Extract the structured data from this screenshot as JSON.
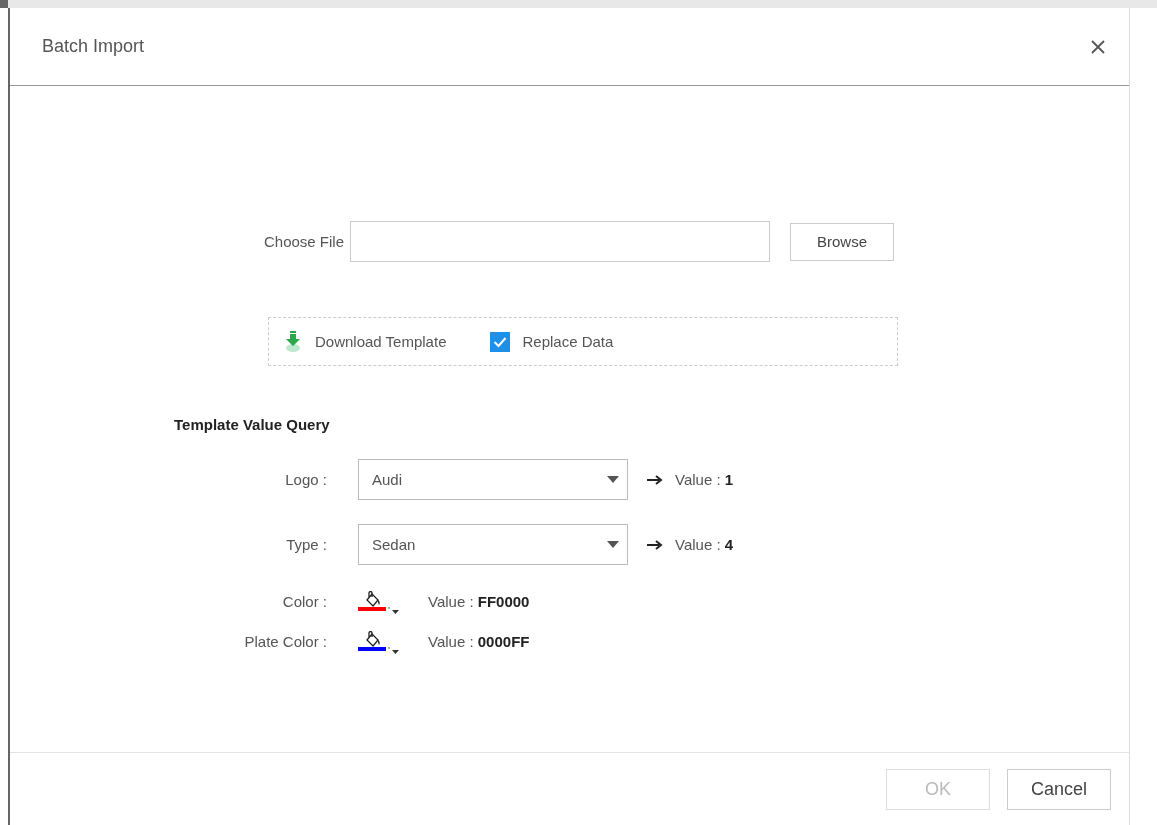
{
  "dialog": {
    "title": "Batch Import"
  },
  "choose_file": {
    "label": "Choose File",
    "browse_button": "Browse"
  },
  "options": {
    "download_link": "Download Template",
    "replace_data": {
      "label": "Replace Data",
      "checked": true
    }
  },
  "template_value_query": {
    "heading": "Template Value Query",
    "selects": [
      {
        "label": "Logo :",
        "value": "Audi",
        "result": "Value : **1**"
      },
      {
        "label": "Type :",
        "value": "Sedan",
        "result": "Value : **4**"
      }
    ],
    "colors": [
      {
        "label": "Color :",
        "color": "#ff0000",
        "result": "Value : **FF0000**"
      },
      {
        "label": "Plate Color :",
        "color": "#0000ff",
        "result": "Value : **0000FF**"
      }
    ]
  },
  "buttons": [
    {
      "label": "OK",
      "disabled": true
    },
    {
      "label": "Cancel",
      "disabled": false
    }
  ]
}
